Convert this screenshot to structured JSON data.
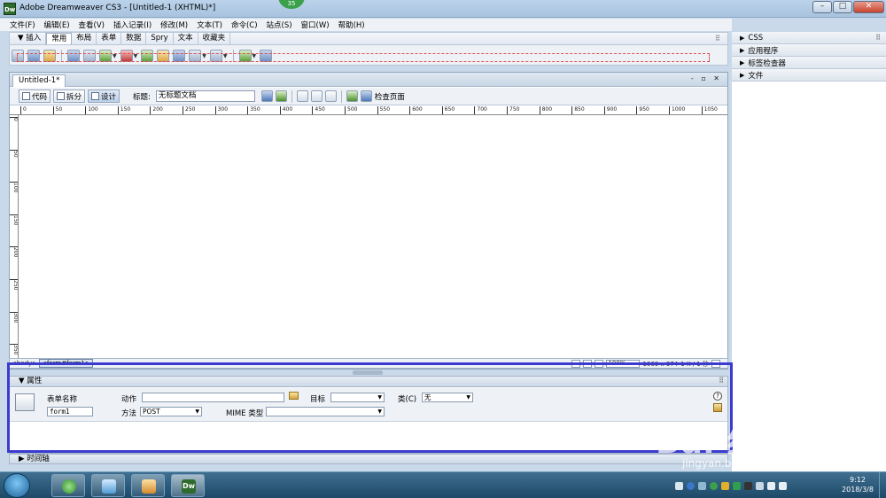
{
  "window": {
    "app_logo": "Dw",
    "title": "Adobe Dreamweaver CS3 - [Untitled-1 (XHTML)*]",
    "notification_count": "35",
    "min": "–",
    "max": "□",
    "close": "✕"
  },
  "menu": [
    "文件(F)",
    "编辑(E)",
    "查看(V)",
    "插入记录(I)",
    "修改(M)",
    "文本(T)",
    "命令(C)",
    "站点(S)",
    "窗口(W)",
    "帮助(H)"
  ],
  "insert_bar": {
    "label": "▼ 插入",
    "tabs": [
      "常用",
      "布局",
      "表单",
      "数据",
      "Spry",
      "文本",
      "收藏夹"
    ],
    "active_tab": "常用",
    "grip": "⠿"
  },
  "panels": {
    "items": [
      "CSS",
      "应用程序",
      "标签检查器",
      "文件"
    ],
    "grip": "⠿"
  },
  "document": {
    "tab": "Untitled-1*",
    "window_buttons": "- ▫ ✕",
    "views": [
      "代码",
      "拆分",
      "设计"
    ],
    "active_view": "设计",
    "title_label": "标题:",
    "title_value": "无标题文档",
    "check_page": "检查页面",
    "ruler_marks": [
      "0",
      "50",
      "100",
      "150",
      "200",
      "250",
      "300",
      "350",
      "400",
      "450",
      "500",
      "550",
      "600",
      "650",
      "700",
      "750",
      "800",
      "850",
      "900",
      "950",
      "1000",
      "1050"
    ],
    "ruler_v_marks": [
      "0",
      "50",
      "100",
      "150",
      "200",
      "250",
      "300",
      "350"
    ]
  },
  "status_bar": {
    "tag_body": "<body>",
    "tag_form": "<form#form1>",
    "zoom": "100%",
    "size": "1069 x 374",
    "weight": "1 K / 1 秒"
  },
  "properties": {
    "header": "▼ 属性",
    "form_name_label": "表单名称",
    "form_name_value": "form1",
    "action_label": "动作",
    "action_value": "",
    "target_label": "目标",
    "target_value": "",
    "class_label": "类(C)",
    "class_value": "无",
    "method_label": "方法",
    "method_value": "POST",
    "mime_label": "MIME 类型",
    "mime_value": "",
    "help": "?",
    "grip": "⠿"
  },
  "timeline": "▶ 时间轴",
  "taskbar": {
    "clock_time": "9:12",
    "clock_date": "2018/3/8",
    "dw_label": "Dw"
  },
  "watermark": {
    "brand": "Bai 经验",
    "url": "jingyan.baidu.com"
  },
  "colors": {
    "highlight": "#3b3bd0",
    "form_outline": "#e05050",
    "dw_green": "#2f6b2e"
  }
}
